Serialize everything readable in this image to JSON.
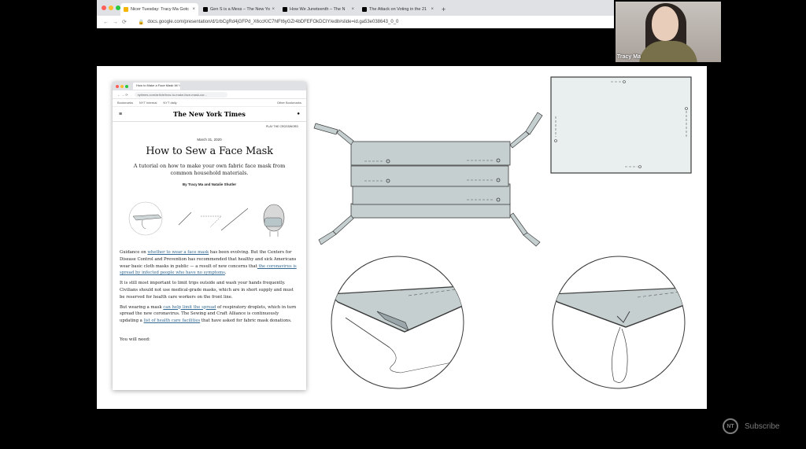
{
  "browser": {
    "tabs": [
      {
        "label": "Nicer Tuesday: Tracy Ma Gotc",
        "active": true,
        "favicon_color": "#f4b400"
      },
      {
        "label": "Gen S is a Mess – The New Yo",
        "active": false,
        "favicon_color": "#000000"
      },
      {
        "label": "How We Juneteenth – The N",
        "active": false,
        "favicon_color": "#000000"
      },
      {
        "label": "The Attack on Voting in the 21",
        "active": false,
        "favicon_color": "#000000"
      }
    ],
    "new_tab": "+",
    "url": "docs.google.com/presentation/d/1rbCgRd4jGFPd_X6ccKIC7hlFt6yGZr4bDFEFOkDCIY/edit#slide=id.ga53e038643_0_0"
  },
  "webcam": {
    "name": "Tracy Ma"
  },
  "article": {
    "tab_label": "How to Make a Face Mask W/ t",
    "url": "nytimes.com/article/how-to-make-face-mask-cor...",
    "bookmarks": [
      "Bookmarks",
      "NYT Internal",
      "NYT daily"
    ],
    "other_bookmarks": "Other Bookmarks",
    "logo": "The New York Times",
    "top_link": "PLAY THE CROSSWORD",
    "date": "March 31, 2020",
    "title": "How to Sew a Face Mask",
    "dek": "A tutorial on how to make your own fabric face mask from common household materials.",
    "byline": "By Tracy Ma and Natalie Shutler",
    "p1": {
      "a": "Guidance on ",
      "link1": "whether to wear a face mask",
      "b": " has been evolving. But the Centers for Disease Control and Prevention has recommended that healthy and sick Americans wear basic cloth masks in public — a result of new concerns that",
      "link2": " the coronavirus is spread by infected people who have no symptoms",
      "c": "."
    },
    "p2": "It is still most important to limit trips outside and wash your hands frequently. Civilians should not use medical-grade masks, which are in short supply and must be reserved for health care workers on the front line.",
    "p3": {
      "a": "But wearing a mask ",
      "link1": "can help limit the spread",
      "b": " of respiratory droplets, which in turn spread the new coronavirus. The Sewing and Craft Alliance is continuously updating a ",
      "link2": "list of health care facilities",
      "c": " that have asked for fabric mask donations."
    },
    "need": "You will need:"
  },
  "subscribe": {
    "label": "Subscribe",
    "icon_text": "NT"
  },
  "colors": {
    "link": "#326891",
    "mask_fill": "#c5cfd0",
    "line": "#3a3a3a"
  }
}
